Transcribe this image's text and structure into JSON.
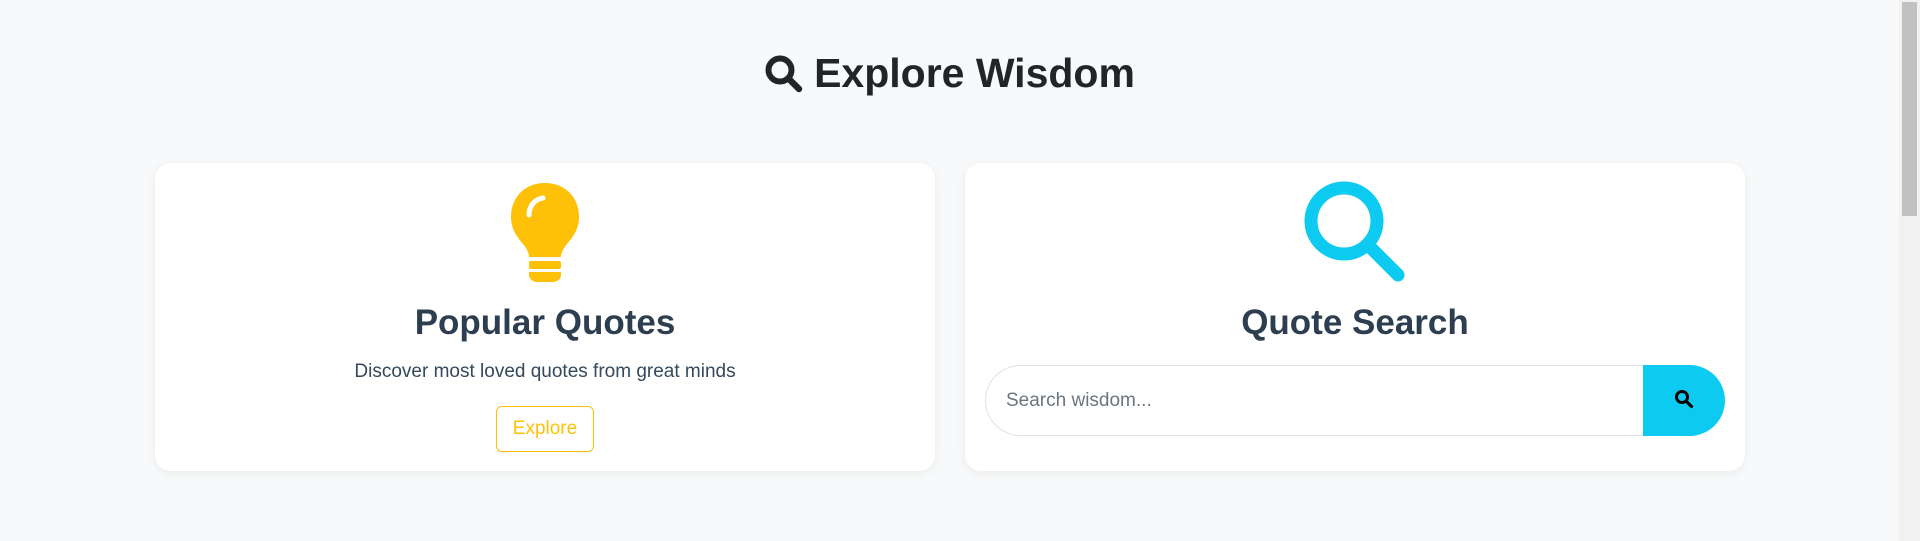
{
  "header": {
    "title": "Explore Wisdom",
    "icon": "search-icon"
  },
  "cards": {
    "popular": {
      "icon": "lightbulb-icon",
      "title": "Popular Quotes",
      "description": "Discover most loved quotes from great minds",
      "button_label": "Explore"
    },
    "search": {
      "icon": "search-icon",
      "title": "Quote Search",
      "placeholder": "Search wisdom...",
      "button_icon": "search-icon"
    }
  },
  "colors": {
    "popular_accent": "#ffc107",
    "search_accent": "#0dcaf0"
  }
}
